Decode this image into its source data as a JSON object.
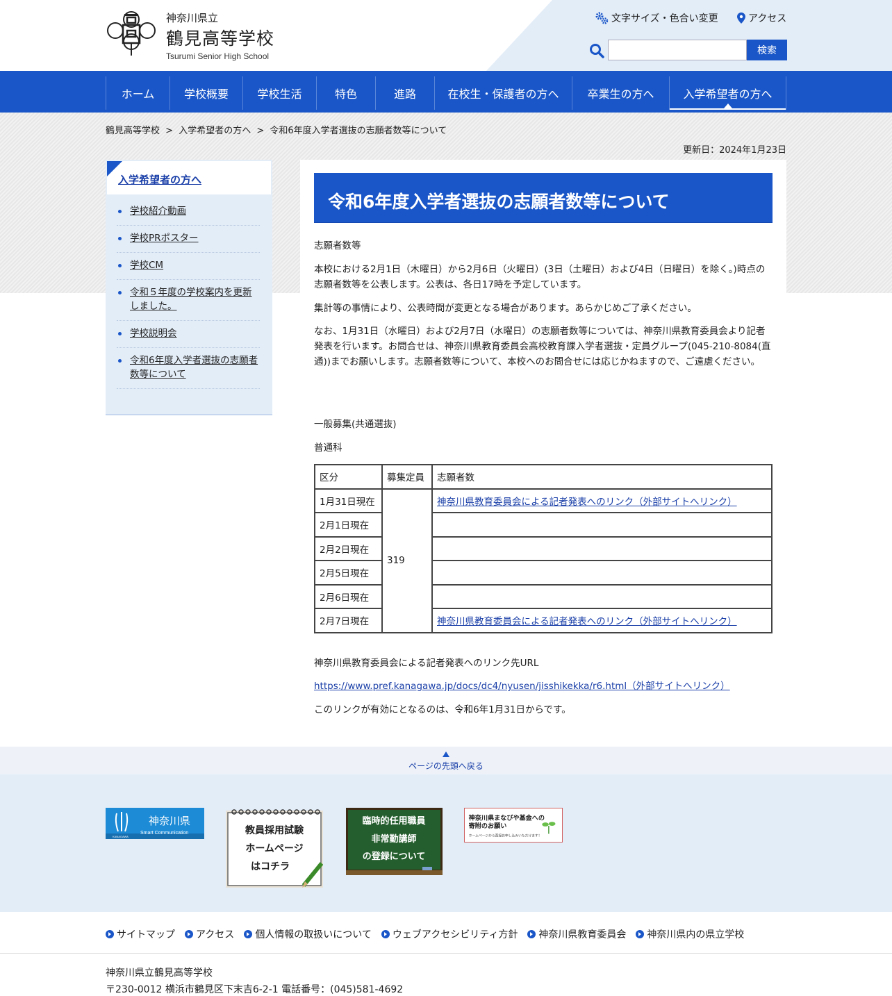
{
  "header": {
    "prefecture": "神奈川県立",
    "school_name": "鶴見高等学校",
    "school_name_en": "Tsurumi Senior High School",
    "font_color_link": "文字サイズ・色合い変更",
    "access_link": "アクセス",
    "search_placeholder": "",
    "search_button": "検索"
  },
  "nav": {
    "items": [
      "ホーム",
      "学校概要",
      "学校生活",
      "特色",
      "進路",
      "在校生・保護者の方へ",
      "卒業生の方へ",
      "入学希望者の方へ"
    ],
    "active": "入学希望者の方へ"
  },
  "breadcrumb": {
    "items": [
      "鶴見高等学校",
      ">",
      "入学希望者の方へ",
      ">",
      "令和6年度入学者選抜の志願者数等について"
    ]
  },
  "updated": "更新日：2024年1月23日",
  "sidebar": {
    "title": "入学希望者の方へ",
    "items": [
      "学校紹介動画",
      "学校PRポスター",
      "学校CM",
      "令和５年度の学校案内を更新しました。",
      "学校説明会",
      "令和6年度入学者選抜の志願者数等について"
    ]
  },
  "main": {
    "title": "令和6年度入学者選抜の志願者数等について",
    "p1": "志願者数等",
    "p2": "本校における2月1日（木曜日）から2月6日（火曜日）(3日（土曜日）および4日（日曜日）を除く。)時点の志願者数等を公表します。公表は、各日17時を予定しています。",
    "p3": "集計等の事情により、公表時間が変更となる場合があります。あらかじめご了承ください。",
    "p4": "なお、1月31日（水曜日）および2月7日（水曜日）の志願者数等については、神奈川県教育委員会より記者発表を行います。お問合せは、神奈川県教育委員会高校教育課入学者選抜・定員グループ(045-210-8084(直通))までお願いします。志願者数等について、本校へのお問合せには応じかねますので、ご遠慮ください。",
    "p5": "一般募集(共通選抜)",
    "p6": "普通科",
    "table": {
      "headers": [
        "区分",
        "募集定員",
        "志願者数"
      ],
      "capacity": "319",
      "rows": [
        {
          "date": "1月31日現在",
          "applicants": "神奈川県教育委員会による記者発表へのリンク（外部サイトへリンク）"
        },
        {
          "date": "2月1日現在",
          "applicants": ""
        },
        {
          "date": "2月2日現在",
          "applicants": ""
        },
        {
          "date": "2月5日現在",
          "applicants": ""
        },
        {
          "date": "2月6日現在",
          "applicants": ""
        },
        {
          "date": "2月7日現在",
          "applicants": "神奈川県教育委員会による記者発表へのリンク（外部サイトへリンク）"
        }
      ]
    },
    "p7": "神奈川県教育委員会による記者発表へのリンク先URL",
    "url_link": "https://www.pref.kanagawa.jp/docs/dc4/nyusen/jisshikekka/r6.html（外部サイトへリンク）",
    "p8": "このリンクが有効にとなるのは、令和6年1月31日からです。"
  },
  "totop": "ページの先頭へ戻る",
  "banners": {
    "b1": {
      "text": "神奈川県",
      "sub": "Smart Communication",
      "small": "KANAGAWA"
    },
    "b2": {
      "line1": "教員採用試験",
      "line2": "ホームページ",
      "line3": "はコチラ"
    },
    "b3": {
      "line1": "臨時的任用職員",
      "line2": "非常勤講師",
      "line3": "の登録について"
    },
    "b4": {
      "line1": "神奈川県まなびや基金への",
      "line2": "寄附のお願い",
      "line3": "ホームページから直接お申し込みいただけます！"
    }
  },
  "footer": {
    "links": [
      "サイトマップ",
      "アクセス",
      "個人情報の取扱いについて",
      "ウェブアクセシビリティ方針",
      "神奈川県教育委員会",
      "神奈川県内の県立学校"
    ],
    "school": "神奈川県立鶴見高等学校",
    "address": "〒230-0012 横浜市鶴見区下末吉6-2-1 電話番号：(045)581-4692"
  },
  "colors": {
    "primary": "#1a56c8",
    "light_bg": "#e3edf8"
  }
}
